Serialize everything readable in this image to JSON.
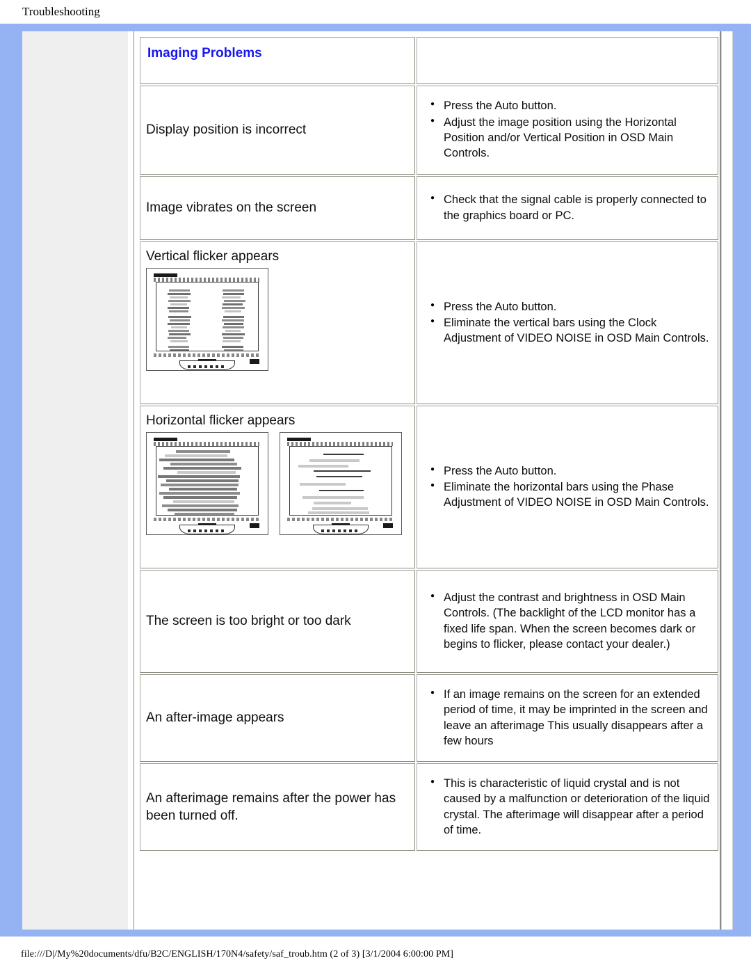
{
  "header": {
    "title": "Troubleshooting"
  },
  "section": {
    "title": "Imaging Problems"
  },
  "rows": [
    {
      "problem": "Display position is incorrect",
      "fixes": [
        "Press the Auto button.",
        "Adjust the image position using the Horizontal Position and/or Vertical Position in OSD Main Controls."
      ]
    },
    {
      "problem": "Image vibrates on the screen",
      "fixes": [
        "Check that the signal cable is properly connected to the graphics board or PC."
      ]
    },
    {
      "problem": "Vertical flicker appears",
      "fixes": [
        "Press the Auto button.",
        "Eliminate the vertical bars using the Clock Adjustment of VIDEO NOISE in OSD Main Controls."
      ]
    },
    {
      "problem": "Horizontal flicker appears",
      "fixes": [
        "Press the Auto button.",
        "Eliminate the horizontal bars using the Phase Adjustment of VIDEO NOISE in OSD Main Controls."
      ]
    },
    {
      "problem": "The screen is too bright or too dark",
      "fixes": [
        "Adjust the contrast and brightness in OSD Main Controls. (The backlight of the LCD monitor has a fixed life span. When the screen becomes dark or begins to flicker, please contact your dealer.)"
      ]
    },
    {
      "problem": "An after-image appears",
      "fixes": [
        "If an image remains on the screen for an extended period of time, it may be imprinted in the screen and leave an afterimage This usually disappears after a few hours"
      ]
    },
    {
      "problem": "An afterimage remains after the power has been turned off.",
      "fixes": [
        "This is characteristic of liquid crystal and is not caused by a malfunction or deterioration of the liquid crystal. The afterimage will disappear after a period of time."
      ]
    }
  ],
  "illustrations": {
    "vertical_flicker_monitor": "lcd-monitor-vertical-noise",
    "horizontal_flicker_monitor_left": "lcd-monitor-horizontal-noise",
    "horizontal_flicker_monitor_right": "lcd-monitor-horizontal-lines"
  },
  "footer": {
    "path": "file:///D|/My%20documents/dfu/B2C/ENGLISH/170N4/safety/saf_troub.htm (2 of 3) [3/1/2004 6:00:00 PM]"
  },
  "colors": {
    "frame_blue": "#95b3f2",
    "heading_blue": "#1818ee",
    "side_panel_gray": "#efefef",
    "cell_border": "#8a8a7e"
  }
}
